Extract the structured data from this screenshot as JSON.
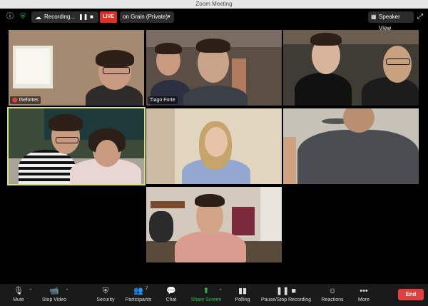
{
  "window": {
    "title": "Zoom Meeting"
  },
  "topbar": {
    "recording_label": "Recording...",
    "live_label": "LIVE",
    "stream_label": "on Grain (Private)",
    "view_label": "Speaker View"
  },
  "participants": [
    {
      "name": "thefortes"
    },
    {
      "name": ""
    },
    {
      "name": "Tiago Forte"
    },
    {
      "name": ""
    },
    {
      "name": ""
    },
    {
      "name": ""
    },
    {
      "name": ""
    },
    {
      "name": ""
    }
  ],
  "toolbar": {
    "mute": "Mute",
    "stop_video": "Stop Video",
    "security": "Security",
    "participants": "Participants",
    "participants_count": "7",
    "chat": "Chat",
    "share_screen": "Share Screen",
    "polling": "Polling",
    "recording": "Pause/Stop Recording",
    "reactions": "Reactions",
    "more": "More",
    "end": "End"
  },
  "colors": {
    "live": "#d9302c",
    "share": "#28c840",
    "end": "#e04040",
    "active_border": "#d6e37a"
  }
}
